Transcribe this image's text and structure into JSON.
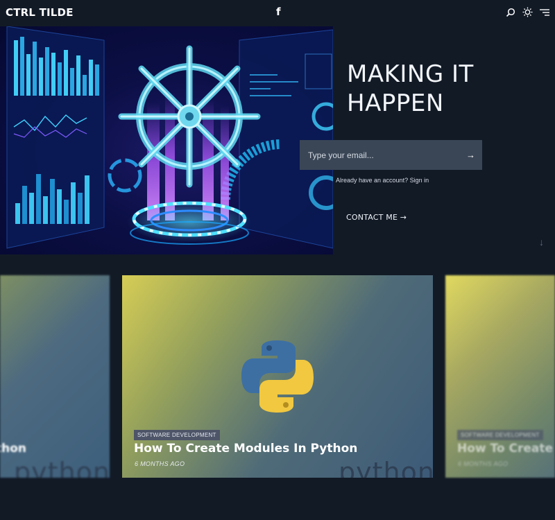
{
  "brand": {
    "logo": "CTRL TILDE"
  },
  "header": {
    "social_label": "f",
    "icons": [
      "search-icon",
      "sun-icon",
      "menu-icon"
    ]
  },
  "hero": {
    "title": "MAKING IT HAPPEN",
    "email_placeholder": "Type your email...",
    "submit_arrow": "→",
    "account_text": "Already have an account? Sign in",
    "contact_label": "CONTACT ME →",
    "scroll_arrow": "↓"
  },
  "cards": {
    "left": {
      "title": "thon",
      "watermark": "python"
    },
    "main": {
      "tag": "SOFTWARE DEVELOPMENT",
      "title": "How To Create Modules In Python",
      "date": "6 MONTHS AGO",
      "watermark": "python"
    },
    "right": {
      "tag": "SOFTWARE DEVELOPMENT",
      "title": "How To Create M",
      "date": "6 MONTHS AGO"
    }
  },
  "colors": {
    "background": "#121a26",
    "input_bg": "#3a4656",
    "python_blue": "#3d6fa3",
    "python_yellow": "#f1c840"
  }
}
